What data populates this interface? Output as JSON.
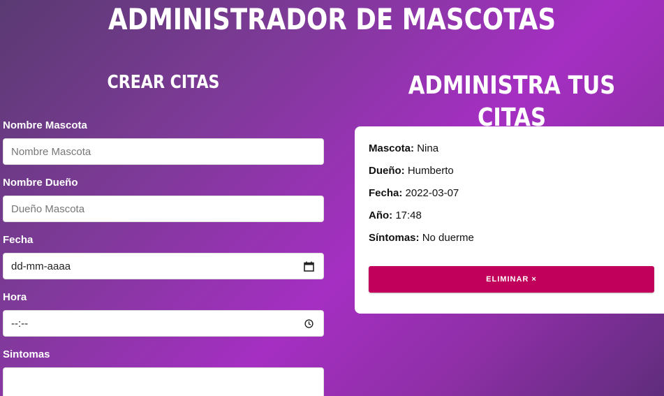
{
  "header": {
    "title": "ADMINISTRADOR DE MASCOTAS"
  },
  "form_section": {
    "title": "CREAR CITAS",
    "fields": [
      {
        "label": "Nombre Mascota",
        "placeholder": "Nombre Mascota"
      },
      {
        "label": "Nombre Dueño",
        "placeholder": "Dueño Mascota"
      },
      {
        "label": "Fecha",
        "value": "dd-mm-aaaa",
        "icon": "calendar-icon"
      },
      {
        "label": "Hora",
        "value": "--:--",
        "icon": "clock-icon"
      },
      {
        "label": "Sintomas",
        "value": ""
      }
    ]
  },
  "appointments_section": {
    "title": "ADMINISTRA TUS CITAS",
    "appointments": [
      {
        "pet_label": "Mascota:",
        "pet": "Nina",
        "owner_label": "Dueño:",
        "owner": "Humberto",
        "date_label": "Fecha:",
        "date": "2022-03-07",
        "time_label": "Año:",
        "time": "17:48",
        "symptoms_label": "Síntomas:",
        "symptoms": "No duerme",
        "delete_label": "ELIMINAR ×"
      }
    ]
  },
  "colors": {
    "accent": "#c0005a",
    "gradient_mid": "#a52fc2"
  }
}
